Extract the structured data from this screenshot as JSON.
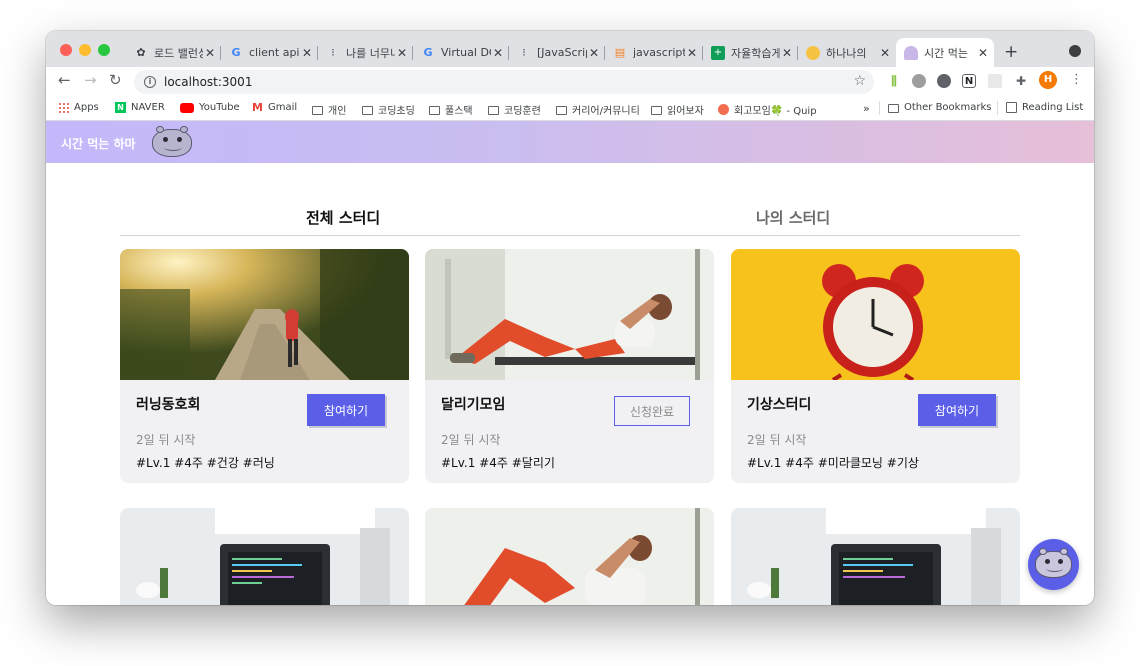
{
  "browser": {
    "tabs": [
      {
        "title": "로드 밸런싱",
        "icon": "puzzle-icon"
      },
      {
        "title": "client api",
        "icon": "google-icon"
      },
      {
        "title": "나를 너무니",
        "icon": "dots-icon"
      },
      {
        "title": "Virtual DOM",
        "icon": "google-icon"
      },
      {
        "title": "[JavaScript",
        "icon": "dots-icon"
      },
      {
        "title": "javascript",
        "icon": "stack-icon"
      },
      {
        "title": "자율학습게",
        "icon": "sheets-icon"
      },
      {
        "title": "하나나의",
        "icon": "emoji-icon"
      },
      {
        "title": "시간 먹는",
        "icon": "hippo-icon"
      }
    ],
    "url": "localhost:3001",
    "bookmarks": [
      {
        "label": "Apps",
        "icon": "apps-icon"
      },
      {
        "label": "NAVER",
        "icon": "naver-icon"
      },
      {
        "label": "YouTube",
        "icon": "youtube-icon"
      },
      {
        "label": "Gmail",
        "icon": "gmail-icon"
      },
      {
        "label": "개인",
        "icon": "folder-icon"
      },
      {
        "label": "코딩초딩",
        "icon": "folder-icon"
      },
      {
        "label": "풀스택",
        "icon": "folder-icon"
      },
      {
        "label": "코딩훈련",
        "icon": "folder-icon"
      },
      {
        "label": "커리어/커뮤니티",
        "icon": "folder-icon"
      },
      {
        "label": "읽어보자",
        "icon": "folder-icon"
      },
      {
        "label": "회고모임🍀 - Quip",
        "icon": "quip-icon"
      }
    ],
    "other_bookmarks": "Other Bookmarks",
    "reading_list": "Reading List",
    "profile_initial": "H"
  },
  "app": {
    "brand": "시간 먹는 하마",
    "tabs": {
      "all": "전체 스터디",
      "mine": "나의 스터디"
    },
    "cards": [
      {
        "title": "러닝동호회",
        "when": "2일 뒤 시작",
        "tags": "#Lv.1 #4주 #건강 #러닝",
        "button": "참여하기",
        "status": "join",
        "image": "runner-photo"
      },
      {
        "title": "달리기모임",
        "when": "2일 뒤 시작",
        "tags": "#Lv.1 #4주 #달리기",
        "button": "신청완료",
        "status": "done",
        "image": "situp-photo"
      },
      {
        "title": "기상스터디",
        "when": "2일 뒤 시작",
        "tags": "#Lv.1 #4주 #미라클모닝 #기상",
        "button": "참여하기",
        "status": "join",
        "image": "alarm-clock-photo"
      }
    ]
  },
  "colors": {
    "accent": "#5b5fe8",
    "hero_start": "#c4b8fb",
    "hero_end": "#e6bfd8"
  }
}
